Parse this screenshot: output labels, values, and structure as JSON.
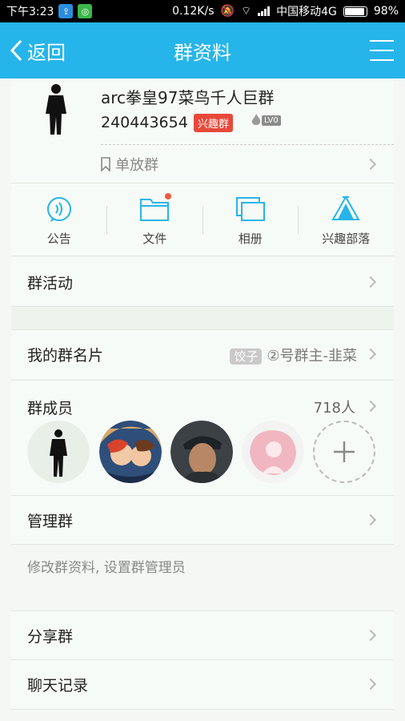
{
  "status_bar": {
    "time": "下午3:23",
    "net_speed": "0.12K/s",
    "carrier": "中国移动4G",
    "battery": "98%"
  },
  "nav": {
    "back_label": "返回",
    "title": "群资料"
  },
  "group": {
    "name": "arc拳皇97菜鸟千人巨群",
    "id": "240443654",
    "tag": "兴趣群",
    "level": "LV0",
    "single_release": "单放群"
  },
  "quick_actions": [
    {
      "label": "公告",
      "icon": "announcement-icon"
    },
    {
      "label": "文件",
      "icon": "folder-icon"
    },
    {
      "label": "相册",
      "icon": "album-icon"
    },
    {
      "label": "兴趣部落",
      "icon": "tribe-tent-icon"
    }
  ],
  "rows": {
    "activity": "群活动",
    "my_card_label": "我的群名片",
    "my_card_badge": "饺子",
    "my_card_value": "②号群主-韭菜",
    "members_label": "群成员",
    "members_count": "718人",
    "manage_label": "管理群",
    "manage_desc": "修改群资料, 设置群管理员",
    "share_label": "分享群",
    "history_label": "聊天记录"
  },
  "colors": {
    "accent": "#26b5ea",
    "tag_red": "#e8483a"
  }
}
